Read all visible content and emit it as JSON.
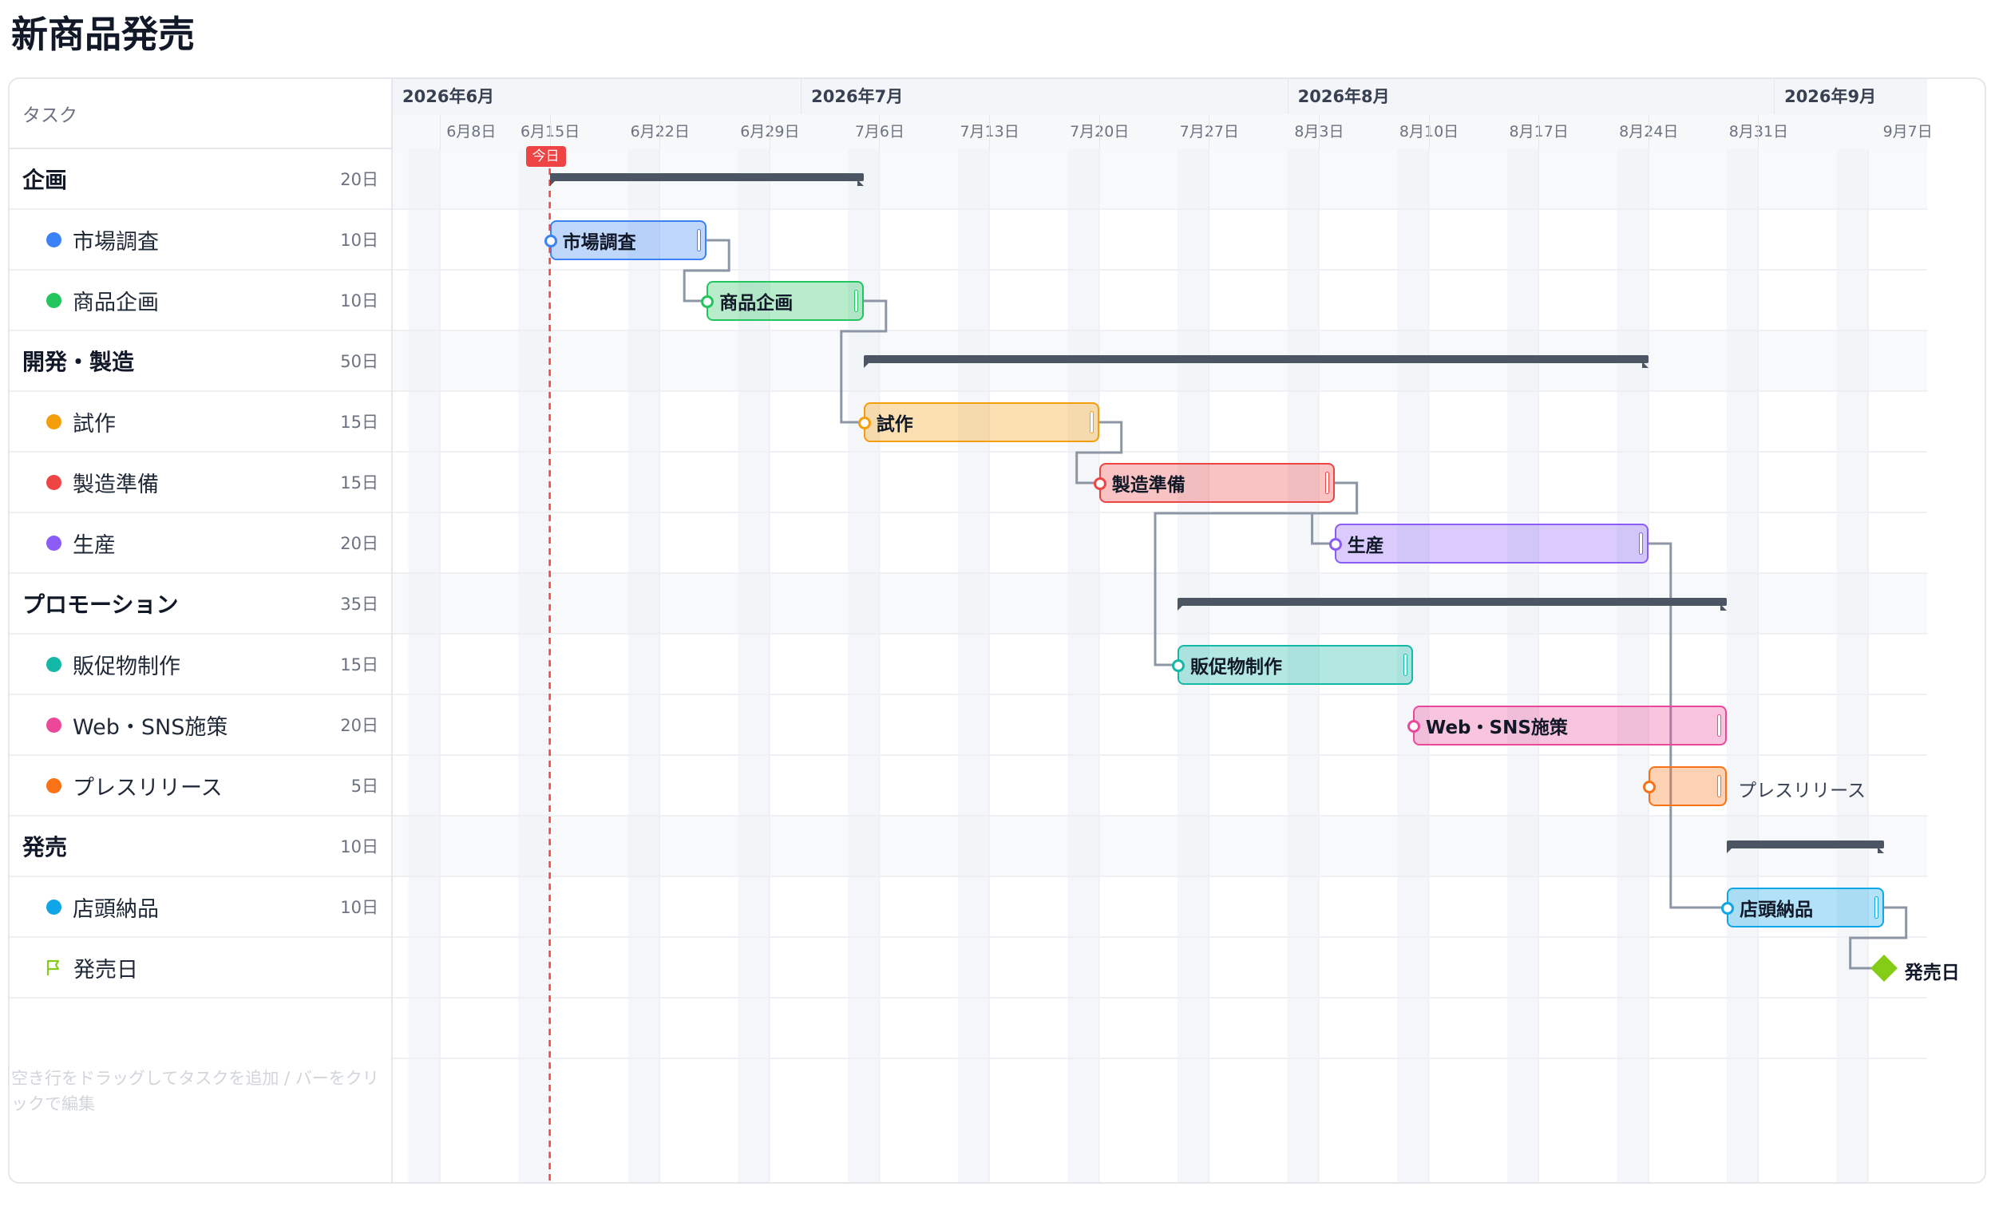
{
  "project": {
    "title": "新商品発売"
  },
  "left_panel": {
    "header": "タスク",
    "hint": "空き行をドラッグしてタスクを追加 / バーをクリックで編集"
  },
  "tasks": [
    {
      "name": "企画",
      "kind": "group",
      "duration": "20日",
      "start": "2026-06-15",
      "end": "2026-07-05"
    },
    {
      "name": "市場調査",
      "kind": "task",
      "duration": "10日",
      "start": "2026-06-15",
      "end": "2026-06-25",
      "color": "#3b82f6"
    },
    {
      "name": "商品企画",
      "kind": "task",
      "duration": "10日",
      "start": "2026-06-25",
      "end": "2026-07-05",
      "color": "#22c55e"
    },
    {
      "name": "開発・製造",
      "kind": "group",
      "duration": "50日",
      "start": "2026-07-05",
      "end": "2026-08-24"
    },
    {
      "name": "試作",
      "kind": "task",
      "duration": "15日",
      "start": "2026-07-05",
      "end": "2026-07-20",
      "color": "#f59e0b"
    },
    {
      "name": "製造準備",
      "kind": "task",
      "duration": "15日",
      "start": "2026-07-20",
      "end": "2026-08-04",
      "color": "#ef4444"
    },
    {
      "name": "生産",
      "kind": "task",
      "duration": "20日",
      "start": "2026-08-04",
      "end": "2026-08-24",
      "color": "#8b5cf6"
    },
    {
      "name": "プロモーション",
      "kind": "group",
      "duration": "35日",
      "start": "2026-07-25",
      "end": "2026-08-29"
    },
    {
      "name": "販促物制作",
      "kind": "task",
      "duration": "15日",
      "start": "2026-07-25",
      "end": "2026-08-09",
      "color": "#14b8a6"
    },
    {
      "name": "Web・SNS施策",
      "kind": "task",
      "duration": "20日",
      "start": "2026-08-09",
      "end": "2026-08-29",
      "color": "#ec4899"
    },
    {
      "name": "プレスリリース",
      "kind": "task",
      "duration": "5日",
      "start": "2026-08-24",
      "end": "2026-08-29",
      "color": "#f97316",
      "label_outside": true
    },
    {
      "name": "発売",
      "kind": "group",
      "duration": "10日",
      "start": "2026-08-29",
      "end": "2026-09-08"
    },
    {
      "name": "店頭納品",
      "kind": "task",
      "duration": "10日",
      "start": "2026-08-29",
      "end": "2026-09-08",
      "color": "#0ea5e9"
    },
    {
      "name": "発売日",
      "kind": "milestone",
      "duration": "",
      "start": "2026-09-08",
      "color": "#84cc16"
    }
  ],
  "timeline": {
    "start": "2026-06-05",
    "end": "2026-09-19",
    "today": "2026-06-15",
    "today_label": "今日",
    "months": [
      {
        "label": "2026年6月",
        "start": "2026-06-05"
      },
      {
        "label": "2026年7月",
        "start": "2026-07-01"
      },
      {
        "label": "2026年8月",
        "start": "2026-08-01"
      },
      {
        "label": "2026年9月",
        "start": "2026-09-01"
      }
    ],
    "weeks": [
      {
        "label": "6月8日",
        "start": "2026-06-08"
      },
      {
        "label": "6月15日",
        "start": "2026-06-15"
      },
      {
        "label": "6月22日",
        "start": "2026-06-22"
      },
      {
        "label": "6月29日",
        "start": "2026-06-29"
      },
      {
        "label": "7月6日",
        "start": "2026-07-06"
      },
      {
        "label": "7月13日",
        "start": "2026-07-13"
      },
      {
        "label": "7月20日",
        "start": "2026-07-20"
      },
      {
        "label": "7月27日",
        "start": "2026-07-27"
      },
      {
        "label": "8月3日",
        "start": "2026-08-03"
      },
      {
        "label": "8月10日",
        "start": "2026-08-10"
      },
      {
        "label": "8月17日",
        "start": "2026-08-17"
      },
      {
        "label": "8月24日",
        "start": "2026-08-24"
      },
      {
        "label": "8月31日",
        "start": "2026-08-31"
      },
      {
        "label": "9月7日",
        "start": "2026-09-07"
      }
    ]
  },
  "dependencies": [
    [
      "市場調査",
      "商品企画"
    ],
    [
      "商品企画",
      "試作"
    ],
    [
      "試作",
      "製造準備"
    ],
    [
      "製造準備",
      "生産"
    ],
    [
      "製造準備",
      "販促物制作"
    ],
    [
      "生産",
      "店頭納品"
    ],
    [
      "店頭納品",
      "発売日"
    ]
  ]
}
